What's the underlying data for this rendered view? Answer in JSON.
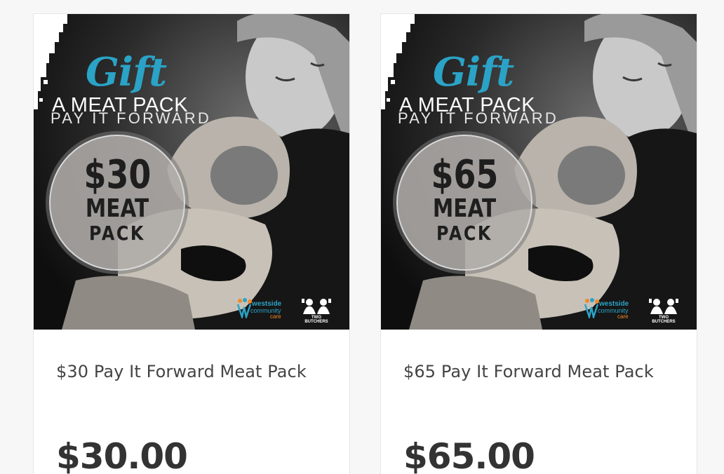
{
  "products": [
    {
      "name": "$30 Pay It Forward Meat Pack",
      "price": "$30.00",
      "image": {
        "gift": "Gift",
        "headline": "A MEAT PACK",
        "subline": "PAY IT FORWARD",
        "amount": "$30",
        "meat": "MEAT",
        "pack": "PACK",
        "logo_wcc_1": "westside",
        "logo_wcc_2": "community",
        "logo_wcc_3": "care",
        "logo_tb": "TWO BUTCHERS"
      }
    },
    {
      "name": "$65 Pay It Forward Meat Pack",
      "price": "$65.00",
      "image": {
        "gift": "Gift",
        "headline": "A MEAT PACK",
        "subline": "PAY IT FORWARD",
        "amount": "$65",
        "meat": "MEAT",
        "pack": "PACK",
        "logo_wcc_1": "westside",
        "logo_wcc_2": "community",
        "logo_wcc_3": "care",
        "logo_tb": "TWO BUTCHERS"
      }
    }
  ],
  "colors": {
    "gift_blue": "#2aa3c6",
    "care_orange": "#f08a2a",
    "price_text": "#333333"
  }
}
